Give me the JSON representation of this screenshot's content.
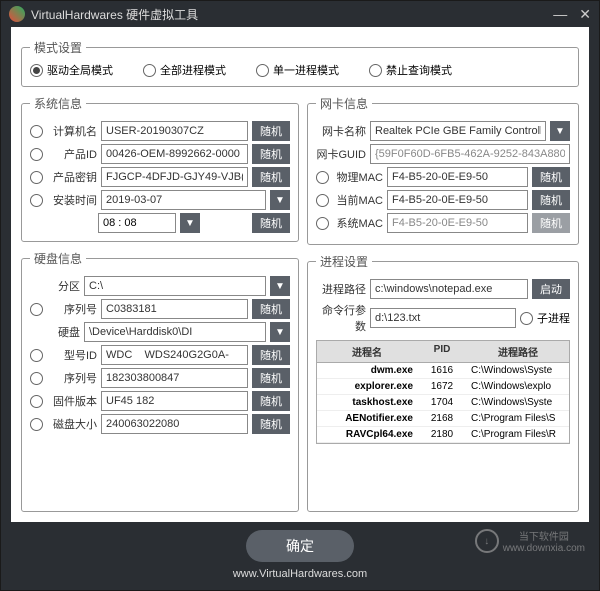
{
  "titlebar": {
    "title": "VirtualHardwares 硬件虚拟工具"
  },
  "mode": {
    "legend": "模式设置",
    "opt1": "驱动全局模式",
    "opt2": "全部进程模式",
    "opt3": "单一进程模式",
    "opt4": "禁止查询模式"
  },
  "sysinfo": {
    "legend": "系统信息",
    "computer_name_label": "计算机名",
    "computer_name": "USER-20190307CZ",
    "product_id_label": "产品ID",
    "product_id": "00426-OEM-8992662-0000",
    "product_key_label": "产品密钥",
    "product_key": "FJGCP-4DFJD-GJY49-VJB(",
    "install_time_label": "安装时间",
    "install_date": "2019-03-07",
    "install_time": "08 : 08",
    "btn_random": "随机"
  },
  "diskinfo": {
    "legend": "硬盘信息",
    "partition_label": "分区",
    "partition": "C:\\",
    "serial_label": "序列号",
    "serial": "C0383181",
    "disk_label": "硬盘",
    "disk": "\\Device\\Harddisk0\\DI",
    "model_label": "型号ID",
    "model": "WDC    WDS240G2G0A-",
    "serial2_label": "序列号",
    "serial2": "182303800847",
    "firmware_label": "固件版本",
    "firmware": "UF45 182",
    "size_label": "磁盘大小",
    "size": "240063022080"
  },
  "netinfo": {
    "legend": "网卡信息",
    "name_label": "网卡名称",
    "name": "Realtek PCIe GBE Family Controll",
    "guid_label": "网卡GUID",
    "guid": "{59F0F60D-6FB5-462A-9252-843A8804",
    "phy_mac_label": "物理MAC",
    "phy_mac": "F4-B5-20-0E-E9-50",
    "cur_mac_label": "当前MAC",
    "cur_mac": "F4-B5-20-0E-E9-50",
    "sys_mac_label": "系统MAC",
    "sys_mac": "F4-B5-20-0E-E9-50"
  },
  "proc": {
    "legend": "进程设置",
    "path_label": "进程路径",
    "path": "c:\\windows\\notepad.exe",
    "btn_start": "启动",
    "args_label": "命令行参数",
    "args": "d:\\123.txt",
    "child_label": "子进程",
    "th_name": "进程名",
    "th_pid": "PID",
    "th_path": "进程路径",
    "rows": [
      {
        "name": "dwm.exe",
        "pid": "1616",
        "path": "C:\\Windows\\Syste"
      },
      {
        "name": "explorer.exe",
        "pid": "1672",
        "path": "C:\\Windows\\explo"
      },
      {
        "name": "taskhost.exe",
        "pid": "1704",
        "path": "C:\\Windows\\Syste"
      },
      {
        "name": "AENotifier.exe",
        "pid": "2168",
        "path": "C:\\Program Files\\S"
      },
      {
        "name": "RAVCpl64.exe",
        "pid": "2180",
        "path": "C:\\Program Files\\R"
      }
    ]
  },
  "confirm": "确定",
  "watermark": {
    "text1": "当下软件园",
    "text2": "www.downxia.com"
  },
  "footer": "www.VirtualHardwares.com"
}
